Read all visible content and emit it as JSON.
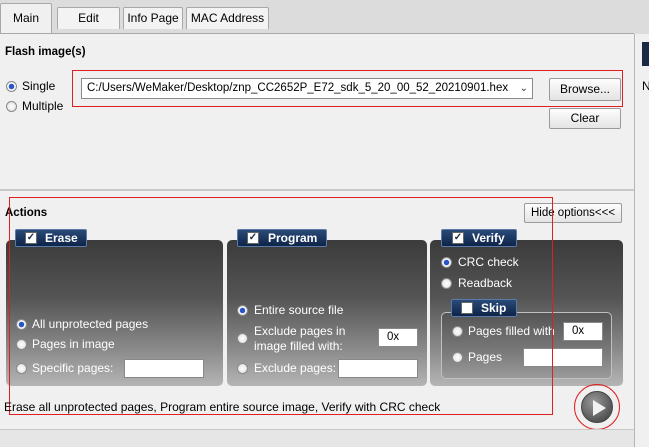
{
  "tabs": [
    {
      "label": "Main",
      "active": true
    },
    {
      "label": "Edit",
      "active": false
    },
    {
      "label": "Info Page",
      "active": false
    },
    {
      "label": "MAC Address",
      "active": false
    }
  ],
  "right_panel": {
    "letter": "N"
  },
  "flash": {
    "title": "Flash image(s)",
    "mode_single": "Single",
    "mode_multiple": "Multiple",
    "selected_mode": "Single",
    "path_value": "C:/Users/WeMaker/Desktop/znp_CC2652P_E72_sdk_5_20_00_52_20210901.hex",
    "browse_label": "Browse...",
    "clear_label": "Clear"
  },
  "actions": {
    "title": "Actions",
    "hide_options_label": "Hide options<<<",
    "erase": {
      "label": "Erase",
      "checked": true,
      "opt_all": "All unprotected pages",
      "opt_image": "Pages in image",
      "opt_specific": "Specific pages:",
      "selected": "All unprotected pages",
      "specific_value": ""
    },
    "program": {
      "label": "Program",
      "checked": true,
      "opt_entire": "Entire source file",
      "opt_exclude_filled_1": "Exclude pages in",
      "opt_exclude_filled_2": "image filled with:",
      "filled_value": "0x",
      "opt_exclude_pages": "Exclude pages:",
      "exclude_value": "",
      "selected": "Entire source file"
    },
    "verify": {
      "label": "Verify",
      "checked": true,
      "opt_crc": "CRC check",
      "opt_readback": "Readback",
      "selected": "CRC check",
      "skip": {
        "label": "Skip",
        "checked": false,
        "opt_filled": "Pages filled with",
        "filled_value": "0x",
        "opt_pages": "Pages",
        "pages_value": ""
      }
    },
    "status_text": "Erase all unprotected pages, Program entire source image, Verify with CRC check"
  },
  "colors": {
    "highlight": "#e02020",
    "header_bg": "#0e2448",
    "radio_selected": "#2a55c8"
  },
  "icons": {
    "play": "play-icon",
    "check": "checkmark-icon"
  }
}
